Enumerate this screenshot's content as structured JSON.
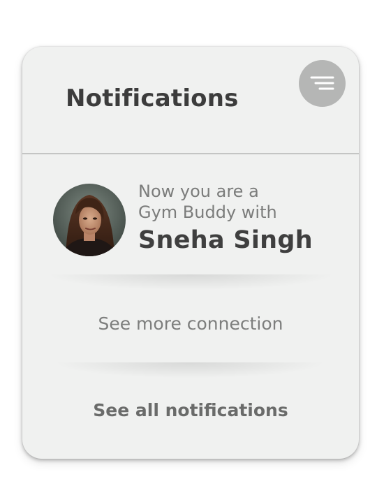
{
  "header": {
    "title": "Notifications",
    "menu_icon": "menu-lines-icon"
  },
  "notification": {
    "line1": "Now you are a",
    "line2": "Gym Buddy with",
    "name": "Sneha Singh",
    "avatar_icon": "user-photo"
  },
  "links": {
    "see_more": "See more connection",
    "see_all": "See all notifications"
  },
  "colors": {
    "card_background": "#f0f1f0",
    "menu_button": "#b5b6b5",
    "title_text": "#3c3c3c",
    "secondary_text": "#7b7c7b"
  }
}
